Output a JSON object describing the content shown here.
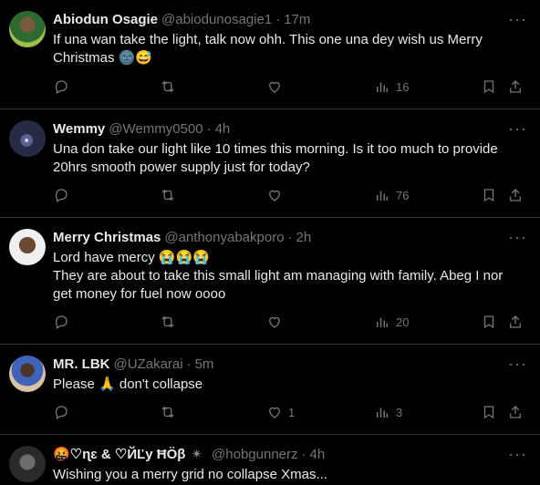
{
  "tweets": [
    {
      "name": "Abiodun Osagie",
      "handle": "@abiodunosagie1",
      "time": "17m",
      "lines": [
        "If una wan take the light, talk now ohh. This one una dey wish us Merry",
        "Christmas 🌚😅"
      ],
      "likes": "",
      "views": "16"
    },
    {
      "name": "Wemmy",
      "handle": "@Wemmy0500",
      "time": "4h",
      "lines": [
        "Una don take our light like 10 times this morning. Is it too much to provide",
        "20hrs smooth power supply just for today?"
      ],
      "likes": "",
      "views": "76"
    },
    {
      "name": "Merry Christmas",
      "handle": "@anthonyabakporo",
      "time": "2h",
      "lines": [
        "Lord have mercy 😭😭😭",
        "They are about to take this small light am managing with family. Abeg I nor",
        "get money for fuel now oooo"
      ],
      "likes": "",
      "views": "20"
    },
    {
      "name": "MR. LBK",
      "handle": "@UZakarai",
      "time": "5m",
      "lines": [
        "Please 🙏 don't collapse"
      ],
      "likes": "1",
      "views": "3"
    },
    {
      "name": "🤬♡ɳɛ & ♡ЙĽy ĦÖβ",
      "sparkle": "✴",
      "handle": "@hobgunnerz",
      "time": "4h",
      "lines": [
        "Wishing you a merry grid no collapse Xmas..."
      ]
    }
  ],
  "separator": "·",
  "more_glyph": "···"
}
